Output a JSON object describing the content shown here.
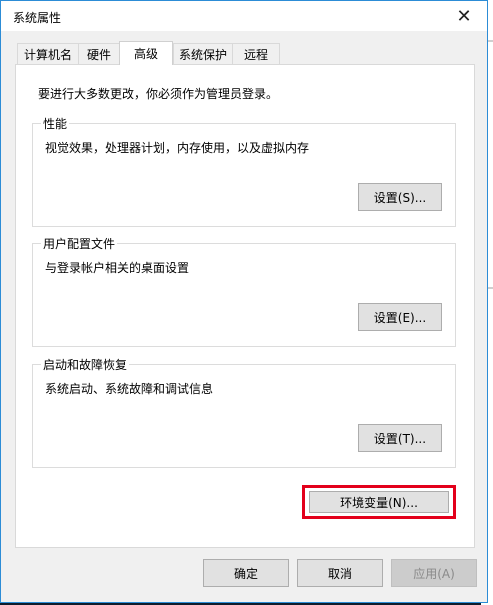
{
  "window": {
    "title": "系统属性"
  },
  "tabs": [
    {
      "label": "计算机名"
    },
    {
      "label": "硬件"
    },
    {
      "label": "高级"
    },
    {
      "label": "系统保护"
    },
    {
      "label": "远程"
    }
  ],
  "active_tab": "高级",
  "notice": "要进行大多数更改，你必须作为管理员登录。",
  "groups": {
    "performance": {
      "title": "性能",
      "description": "视觉效果，处理器计划，内存使用，以及虚拟内存",
      "button": "设置(S)..."
    },
    "user_profiles": {
      "title": "用户配置文件",
      "description": "与登录帐户相关的桌面设置",
      "button": "设置(E)..."
    },
    "startup_recovery": {
      "title": "启动和故障恢复",
      "description": "系统启动、系统故障和调试信息",
      "button": "设置(T)..."
    }
  },
  "env_button": "环境变量(N)...",
  "footer": {
    "ok": "确定",
    "cancel": "取消",
    "apply": "应用(A)"
  },
  "icons": {
    "close": "close-icon"
  },
  "colors": {
    "highlight": "#e3001b",
    "window_border": "#2c8cd6"
  }
}
